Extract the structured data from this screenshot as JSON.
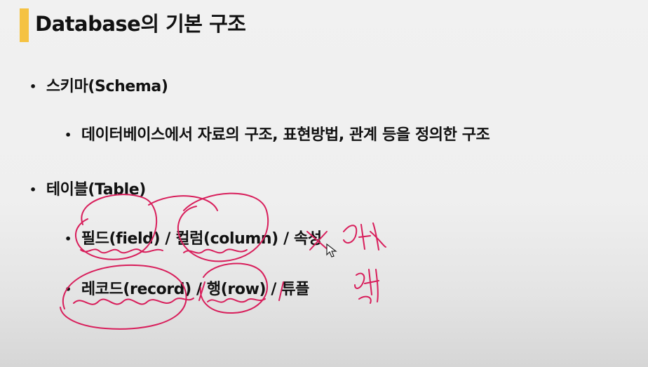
{
  "slide": {
    "title": "Database의 기본 구조",
    "accent_color": "#f5c242",
    "bullets": [
      {
        "label": "스키마(Schema)",
        "children": [
          "데이터베이스에서 자료의 구조, 표현방법, 관계 등을 정의한 구조"
        ]
      },
      {
        "label": "테이블(Table)",
        "children": [
          "필드(field) / 컬럼(column) / 속성",
          "레코드(record) / 행(row) / 튜플"
        ]
      }
    ]
  },
  "annotation": {
    "ink_color": "#d81e5b"
  }
}
